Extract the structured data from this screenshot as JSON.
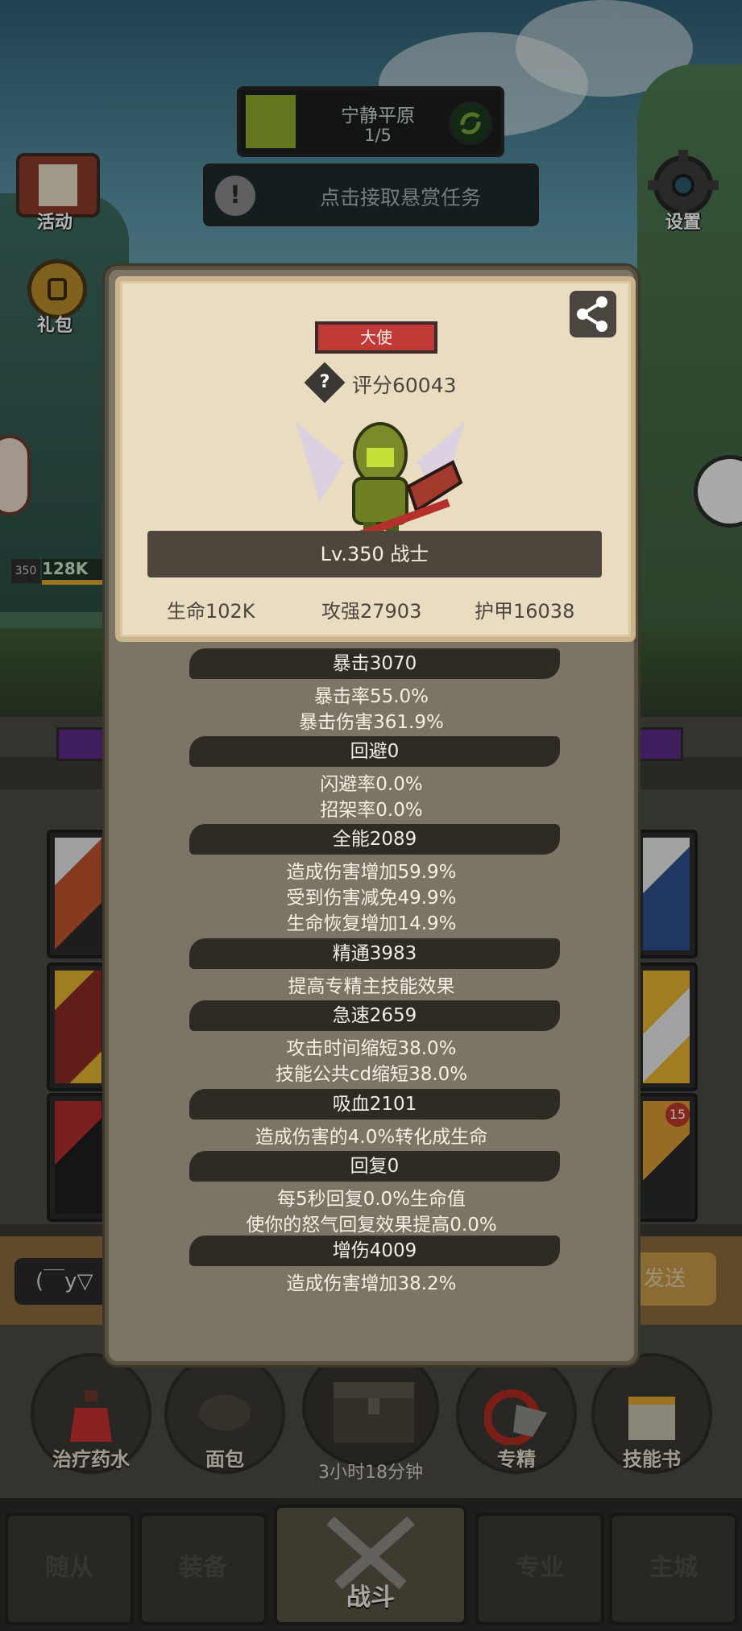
{
  "hud": {
    "zone_title": "宁静平原",
    "zone_progress": "1/5",
    "quest_text": "点击接取悬赏任务",
    "quest_icon": "!",
    "activity_label": "活动",
    "gift_label": "礼包",
    "settings_label": "设置",
    "player_level_chip": "350",
    "player_hp": "128K"
  },
  "chat": {
    "input_preview": "(￣y▽",
    "send_label": "发送"
  },
  "consumables": [
    {
      "label": "治疗药水",
      "icon": "potion-icon"
    },
    {
      "label": "面包",
      "icon": "bread-icon"
    },
    {
      "label": "专精",
      "icon": "specialization-icon"
    },
    {
      "label": "技能书",
      "icon": "skill-book-icon"
    }
  ],
  "chest_timer": "3小时18分钟",
  "bottom_nav": [
    {
      "label": "随从"
    },
    {
      "label": "装备"
    },
    {
      "label": "战斗",
      "active": true
    },
    {
      "label": "专业"
    },
    {
      "label": "主城"
    }
  ],
  "side_slot_badge": "15",
  "card": {
    "rank": "大使",
    "score": "评分60043",
    "score_help": "?",
    "level": "Lv.350 战士",
    "hp": "生命102K",
    "power": "攻强27903",
    "armor": "护甲16038"
  },
  "attributes": [
    {
      "header": "暴击3070",
      "lines": [
        "暴击率55.0%",
        "暴击伤害361.9%"
      ]
    },
    {
      "header": "回避0",
      "lines": [
        "闪避率0.0%",
        "招架率0.0%"
      ]
    },
    {
      "header": "全能2089",
      "lines": [
        "造成伤害增加59.9%",
        "受到伤害减免49.9%",
        "生命恢复增加14.9%"
      ]
    },
    {
      "header": "精通3983",
      "lines": [
        "提高专精主技能效果"
      ]
    },
    {
      "header": "急速2659",
      "lines": [
        "攻击时间缩短38.0%",
        "技能公共cd缩短38.0%"
      ]
    },
    {
      "header": "吸血2101",
      "lines": [
        "造成伤害的4.0%转化成生命"
      ]
    },
    {
      "header": "回复0",
      "lines": [
        "每5秒回复0.0%生命值",
        "使你的怒气回复效果提高0.0%"
      ]
    },
    {
      "header": "增伤4009",
      "lines": [
        "造成伤害增加38.2%"
      ]
    }
  ],
  "colors": {
    "modal_bg": "#7c7464",
    "card_bg": "#e9dcc0",
    "rank_red": "#c23a37",
    "header_dark": "#2e2a24"
  }
}
